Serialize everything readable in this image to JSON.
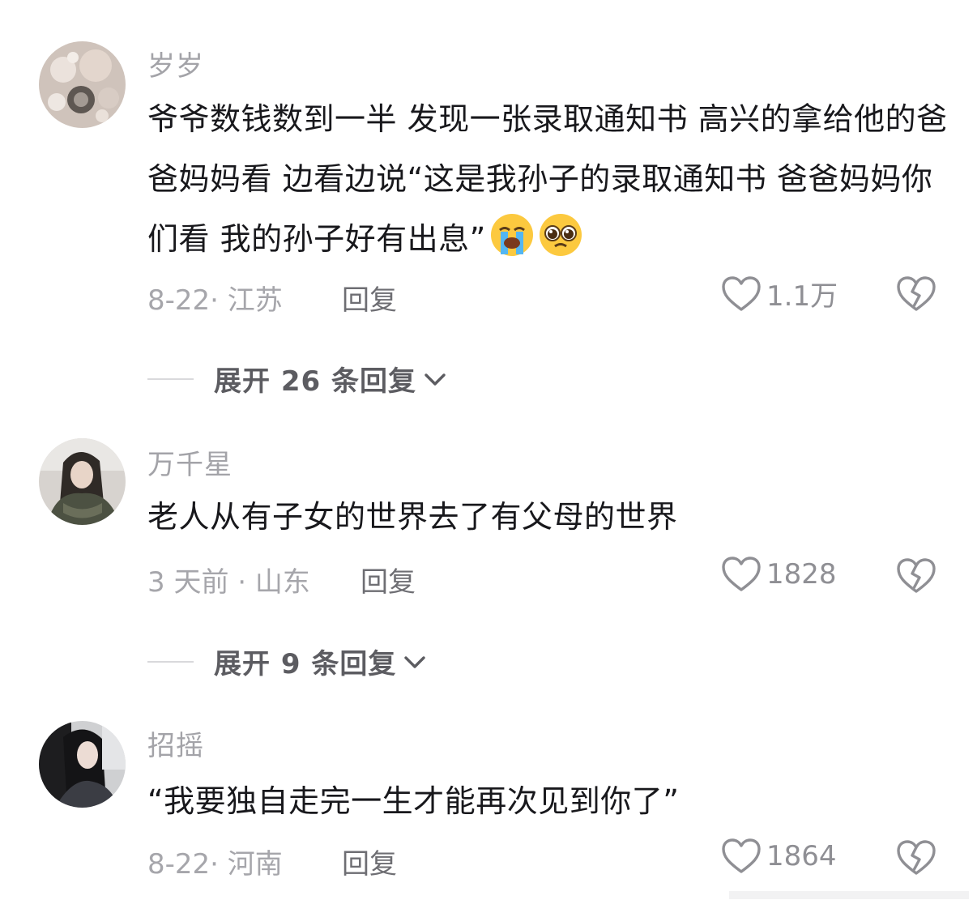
{
  "comments": [
    {
      "username": "岁岁",
      "text": "爷爷数钱数到一半 发现一张录取通知书 高兴的拿给他的爸爸妈妈看 边看边说“这是我孙子的录取通知书 爸爸妈妈你们看 我的孙子好有出息”",
      "emojis": [
        "loudly-crying-face",
        "pleading-face"
      ],
      "meta": "8-22· 江苏",
      "reply_label": "回复",
      "likes": "1.1万",
      "expand_label": "展开 26 条回复"
    },
    {
      "username": "万千星",
      "text": "老人从有子女的世界去了有父母的世界",
      "meta": "3 天前 · 山东",
      "reply_label": "回复",
      "likes": "1828",
      "expand_label": "展开 9 条回复"
    },
    {
      "username": "招摇",
      "text": "“我要独自走完一生才能再次见到你了”",
      "meta": "8-22· 河南",
      "reply_label": "回复",
      "likes": "1864"
    }
  ],
  "colors": {
    "username": "#a3a3a8",
    "text": "#18181c",
    "meta": "#a6a6ab",
    "reply": "#6e6e73",
    "expand": "#5c5c61",
    "icon": "#8f8f94"
  }
}
